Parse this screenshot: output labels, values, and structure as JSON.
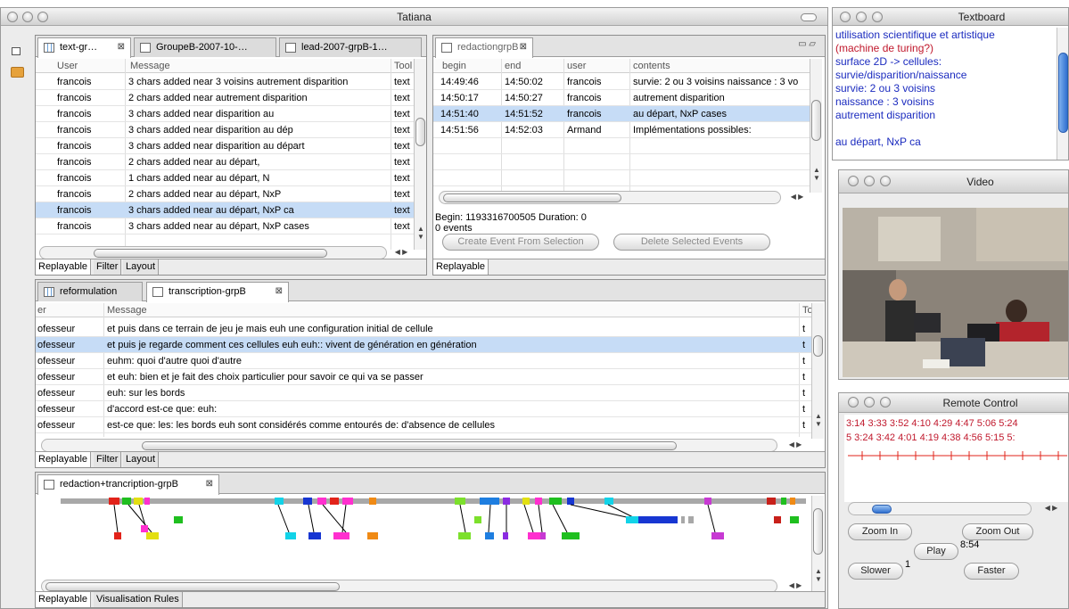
{
  "main_window": {
    "title": "Tatiana",
    "top_left_panel": {
      "tabs": [
        {
          "label": "text-gr…",
          "icon": "grid-icon"
        },
        {
          "label": "GroupeB-2007-10-…",
          "icon": "text-doc-icon"
        },
        {
          "label": "lead-2007-grpB-1…",
          "icon": "text-doc-icon"
        }
      ],
      "columns": [
        "User",
        "Message",
        "Tool"
      ],
      "rows": [
        {
          "user": "francois",
          "message": "3 chars added near  3 voisins autrement disparition",
          "tool": "text"
        },
        {
          "user": "francois",
          "message": "2 chars added near  autrement disparition",
          "tool": "text"
        },
        {
          "user": "francois",
          "message": "3 chars added near  disparition  au",
          "tool": "text"
        },
        {
          "user": "francois",
          "message": "3 chars added near  disparition  au dép",
          "tool": "text"
        },
        {
          "user": "francois",
          "message": "3 chars added near  disparition  au départ",
          "tool": "text"
        },
        {
          "user": "francois",
          "message": "2 chars added near   au départ,",
          "tool": "text"
        },
        {
          "user": "francois",
          "message": "1 chars added near   au départ, N",
          "tool": "text"
        },
        {
          "user": "francois",
          "message": "2 chars added near   au départ, NxP",
          "tool": "text"
        },
        {
          "user": "francois",
          "message": "3 chars added near  au départ, NxP ca",
          "tool": "text"
        },
        {
          "user": "francois",
          "message": "3 chars added near  au départ, NxP cases",
          "tool": "text"
        }
      ],
      "bottom_tabs": [
        "Replayable",
        "Filter",
        "Layout"
      ]
    },
    "top_right_panel": {
      "tab": "redactiongrpB",
      "columns": [
        "begin",
        "end",
        "user",
        "contents"
      ],
      "rows": [
        {
          "begin": "14:49:46",
          "end": "14:50:02",
          "user": "francois",
          "contents": "survie: 2 ou 3 voisins naissance : 3 vo"
        },
        {
          "begin": "14:50:17",
          "end": "14:50:27",
          "user": "francois",
          "contents": "autrement disparition"
        },
        {
          "begin": "14:51:40",
          "end": "14:51:52",
          "user": "francois",
          "contents": "au départ, NxP cases"
        },
        {
          "begin": "14:51:56",
          "end": "14:52:03",
          "user": "Armand",
          "contents": "Implémentations possibles:"
        }
      ],
      "begin_duration": "Begin: 1193316700505 Duration: 0",
      "events": "0 events",
      "create_button": "Create Event From Selection",
      "delete_button": "Delete Selected Events",
      "bottom_tabs": [
        "Replayable"
      ]
    },
    "middle_panel": {
      "tabs": [
        {
          "label": "reformulation",
          "icon": "grid-icon"
        },
        {
          "label": "transcription-grpB",
          "icon": "text-doc-icon"
        }
      ],
      "columns": [
        "er",
        "Message",
        "Too"
      ],
      "rows": [
        {
          "user": "ofesseur",
          "message": "et puis dans ce terrain de jeu je mais euh une configuration initial de cellule",
          "tool": "t"
        },
        {
          "user": "ofesseur",
          "message": "et puis je regarde comment ces cellules euh euh:: vivent de génération en génération",
          "tool": "t"
        },
        {
          "user": "ofesseur",
          "message": "euhm: quoi d'autre quoi d'autre",
          "tool": "t"
        },
        {
          "user": "ofesseur",
          "message": "et euh: bien et je fait des choix particulier pour savoir ce qui va se passer",
          "tool": "t"
        },
        {
          "user": "ofesseur",
          "message": "euh: sur les bords",
          "tool": "t"
        },
        {
          "user": "ofesseur",
          "message": "d'accord est-ce que: euh:",
          "tool": "t"
        },
        {
          "user": "ofesseur",
          "message": "est-ce que: les: les bords euh sont considérés comme entourés de: d'absence de cellules",
          "tool": "t"
        }
      ],
      "bottom_tabs": [
        "Replayable",
        "Filter",
        "Layout"
      ]
    },
    "bottom_panel": {
      "tab": "redaction+trancription-grpB",
      "bottom_tabs": [
        "Replayable",
        "Visualisation Rules"
      ]
    }
  },
  "textboard": {
    "title": "Textboard",
    "lines": [
      {
        "text": "utilisation scientifique et artistique",
        "color": "#1b2bbf"
      },
      {
        "text": "(machine de turing?)",
        "color": "#c0182c"
      },
      {
        "text": "surface 2D -> cellules:",
        "color": "#1b2bbf"
      },
      {
        "text": "survie/disparition/naissance",
        "color": "#1b2bbf"
      },
      {
        "text": "survie: 2 ou 3 voisins",
        "color": "#1b2bbf"
      },
      {
        "text": "naissance : 3 voisins",
        "color": "#1b2bbf"
      },
      {
        "text": "autrement disparition",
        "color": "#1b2bbf"
      },
      {
        "text": "",
        "color": "#1b2bbf"
      },
      {
        "text": "au départ, NxP ca",
        "color": "#1b2bbf"
      }
    ]
  },
  "video": {
    "title": "Video"
  },
  "remote_control": {
    "title": "Remote Control",
    "ticks_row1": "3:14  3:33  3:52  4:10  4:29  4:47  5:06  5:24",
    "ticks_row2": "5  3:24  3:42  4:01  4:19  4:38  4:56  5:15  5:",
    "zoom_in": "Zoom In",
    "zoom_out": "Zoom Out",
    "play": "Play",
    "time": "8:54",
    "slower": "Slower",
    "speed": "1",
    "faster": "Faster"
  }
}
